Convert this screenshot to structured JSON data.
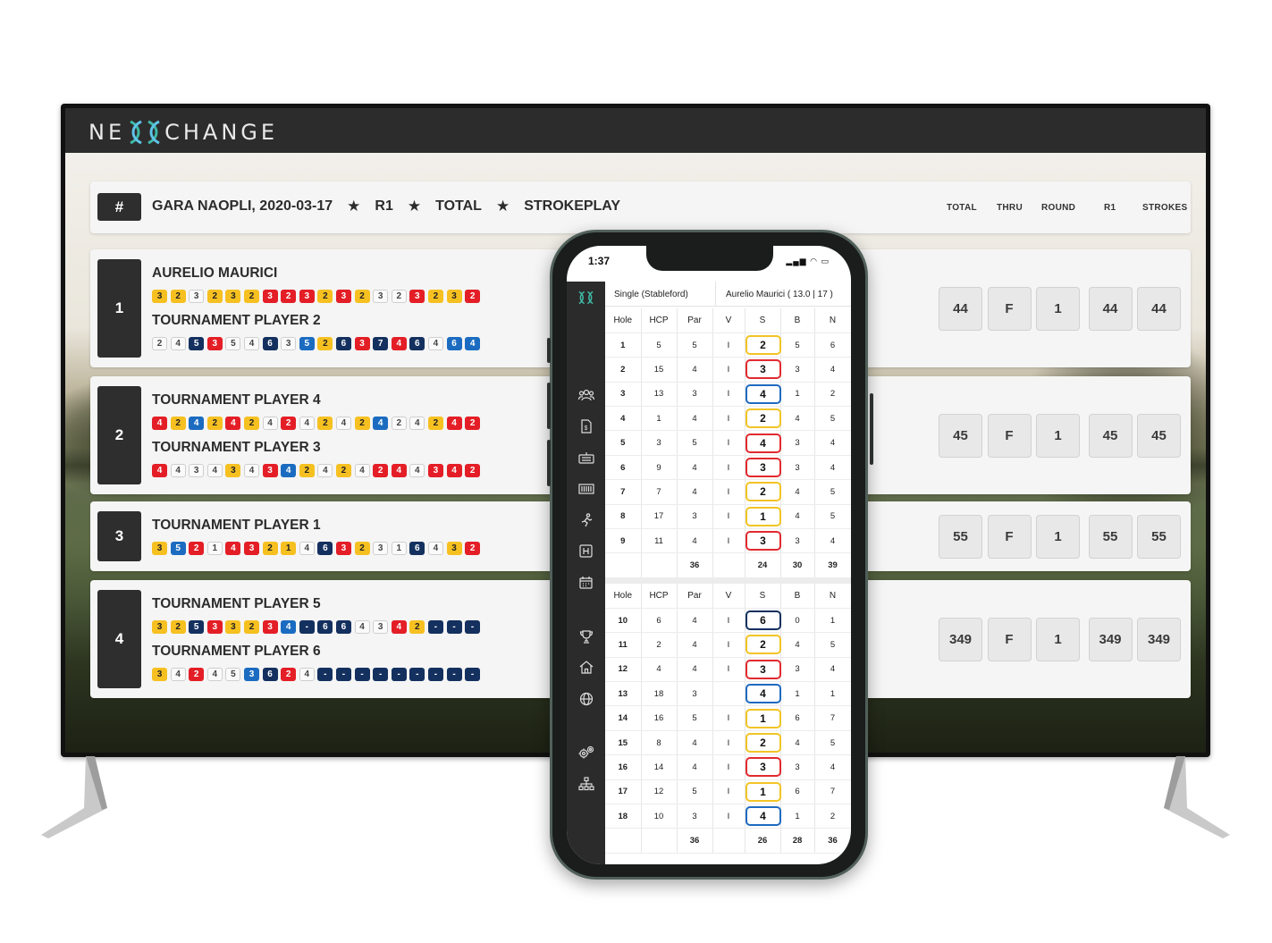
{
  "app": {
    "logo_left": "NE",
    "logo_right": "CHANGE"
  },
  "tv_header": {
    "hash": "#",
    "event": "GARA NAOPLI, 2020-03-17",
    "round": "R1",
    "view": "TOTAL",
    "format": "STROKEPLAY",
    "columns": [
      "TOTAL",
      "THRU",
      "ROUND",
      "R1",
      "STROKES"
    ]
  },
  "leaderboard": [
    {
      "position": "1",
      "players": [
        {
          "name": "AURELIO MAURICI",
          "scores": [
            "3",
            "2",
            "3",
            "2",
            "3",
            "2",
            "3",
            "2",
            "3",
            "2",
            "3",
            "2",
            "3",
            "2",
            "3",
            "2",
            "3",
            "2"
          ],
          "colors": [
            "y",
            "y",
            "w",
            "y",
            "y",
            "y",
            "r",
            "r",
            "r",
            "y",
            "r",
            "y",
            "w",
            "w",
            "r",
            "y",
            "y",
            "r"
          ]
        },
        {
          "name": "TOURNAMENT PLAYER 2",
          "scores": [
            "2",
            "4",
            "5",
            "3",
            "5",
            "4",
            "6",
            "3",
            "5",
            "2",
            "6",
            "3",
            "7",
            "4",
            "6",
            "4",
            "6",
            "4"
          ],
          "colors": [
            "w",
            "w",
            "n",
            "r",
            "w",
            "w",
            "n",
            "w",
            "b",
            "y",
            "n",
            "r",
            "n",
            "r",
            "n",
            "w",
            "b",
            "b"
          ]
        }
      ],
      "stats": [
        "44",
        "F",
        "1",
        "44",
        "44"
      ]
    },
    {
      "position": "2",
      "players": [
        {
          "name": "TOURNAMENT PLAYER 4",
          "scores": [
            "4",
            "2",
            "4",
            "2",
            "4",
            "2",
            "4",
            "2",
            "4",
            "2",
            "4",
            "2",
            "4",
            "2",
            "4",
            "2",
            "4",
            "2"
          ],
          "colors": [
            "r",
            "y",
            "b",
            "y",
            "r",
            "y",
            "w",
            "r",
            "w",
            "y",
            "w",
            "y",
            "b",
            "w",
            "w",
            "y",
            "r",
            "r"
          ]
        },
        {
          "name": "TOURNAMENT PLAYER 3",
          "scores": [
            "4",
            "4",
            "3",
            "4",
            "3",
            "4",
            "3",
            "4",
            "2",
            "4",
            "2",
            "4",
            "2",
            "4",
            "4",
            "3",
            "4",
            "2"
          ],
          "colors": [
            "r",
            "w",
            "w",
            "w",
            "y",
            "w",
            "r",
            "b",
            "y",
            "w",
            "y",
            "w",
            "r",
            "r",
            "w",
            "r",
            "r",
            "r"
          ]
        }
      ],
      "stats": [
        "45",
        "F",
        "1",
        "45",
        "45"
      ]
    },
    {
      "position": "3",
      "players": [
        {
          "name": "TOURNAMENT PLAYER 1",
          "scores": [
            "3",
            "5",
            "2",
            "1",
            "4",
            "3",
            "2",
            "1",
            "4",
            "6",
            "3",
            "2",
            "3",
            "1",
            "6",
            "4",
            "3",
            "2"
          ],
          "colors": [
            "y",
            "b",
            "r",
            "w",
            "r",
            "r",
            "y",
            "y",
            "w",
            "n",
            "r",
            "y",
            "w",
            "w",
            "n",
            "w",
            "y",
            "r"
          ]
        }
      ],
      "stats": [
        "55",
        "F",
        "1",
        "55",
        "55"
      ]
    },
    {
      "position": "4",
      "players": [
        {
          "name": "TOURNAMENT PLAYER 5",
          "scores": [
            "3",
            "2",
            "5",
            "3",
            "3",
            "2",
            "3",
            "4",
            "-",
            "6",
            "6",
            "4",
            "3",
            "4",
            "2",
            "-",
            "-",
            "-"
          ],
          "colors": [
            "y",
            "y",
            "n",
            "r",
            "y",
            "y",
            "r",
            "b",
            "n",
            "n",
            "n",
            "w",
            "w",
            "r",
            "y",
            "n",
            "n",
            "n"
          ]
        },
        {
          "name": "TOURNAMENT PLAYER 6",
          "scores": [
            "3",
            "4",
            "2",
            "4",
            "5",
            "3",
            "6",
            "2",
            "4",
            "-",
            "-",
            "-",
            "-",
            "-",
            "-",
            "-",
            "-",
            "-"
          ],
          "colors": [
            "y",
            "w",
            "r",
            "w",
            "w",
            "b",
            "n",
            "r",
            "w",
            "n",
            "n",
            "n",
            "n",
            "n",
            "n",
            "n",
            "n",
            "n"
          ]
        }
      ],
      "stats": [
        "349",
        "F",
        "1",
        "349",
        "349"
      ]
    }
  ],
  "phone": {
    "time": "1:37",
    "format_label": "Single (Stableford)",
    "player_label": "Aurelio Maurici ( 13.0 | 17 )",
    "columns": [
      "Hole",
      "HCP",
      "Par",
      "V",
      "S",
      "B",
      "N"
    ],
    "front_nine": [
      [
        "1",
        "5",
        "5",
        "I",
        "2",
        "5",
        "6",
        "y"
      ],
      [
        "2",
        "15",
        "4",
        "I",
        "3",
        "3",
        "4",
        "r"
      ],
      [
        "3",
        "13",
        "3",
        "I",
        "4",
        "1",
        "2",
        "b"
      ],
      [
        "4",
        "1",
        "4",
        "I",
        "2",
        "4",
        "5",
        "y"
      ],
      [
        "5",
        "3",
        "5",
        "I",
        "4",
        "3",
        "4",
        "r"
      ],
      [
        "6",
        "9",
        "4",
        "I",
        "3",
        "3",
        "4",
        "r"
      ],
      [
        "7",
        "7",
        "4",
        "I",
        "2",
        "4",
        "5",
        "y"
      ],
      [
        "8",
        "17",
        "3",
        "I",
        "1",
        "4",
        "5",
        "y"
      ],
      [
        "9",
        "11",
        "4",
        "I",
        "3",
        "3",
        "4",
        "r"
      ]
    ],
    "front_totals": [
      "",
      "",
      "36",
      "",
      "24",
      "30",
      "39"
    ],
    "back_nine": [
      [
        "10",
        "6",
        "4",
        "I",
        "6",
        "0",
        "1",
        "n"
      ],
      [
        "11",
        "2",
        "4",
        "I",
        "2",
        "4",
        "5",
        "y"
      ],
      [
        "12",
        "4",
        "4",
        "I",
        "3",
        "3",
        "4",
        "r"
      ],
      [
        "13",
        "18",
        "3",
        "",
        "4",
        "1",
        "1",
        "b"
      ],
      [
        "14",
        "16",
        "5",
        "I",
        "1",
        "6",
        "7",
        "y"
      ],
      [
        "15",
        "8",
        "4",
        "I",
        "2",
        "4",
        "5",
        "y"
      ],
      [
        "16",
        "14",
        "4",
        "I",
        "3",
        "3",
        "4",
        "r"
      ],
      [
        "17",
        "12",
        "5",
        "I",
        "1",
        "6",
        "7",
        "y"
      ],
      [
        "18",
        "10",
        "3",
        "I",
        "4",
        "1",
        "2",
        "b"
      ]
    ],
    "back_totals": [
      "",
      "",
      "36",
      "",
      "26",
      "28",
      "36"
    ]
  },
  "icons": [
    "logo-mark-icon",
    "players-icon",
    "scorecard-icon",
    "keyboard-icon",
    "barcode-icon",
    "runner-icon",
    "h-square-icon",
    "calendar-icon",
    "trophy-icon",
    "home-icon",
    "globe-icon",
    "settings-icon",
    "hierarchy-icon"
  ]
}
